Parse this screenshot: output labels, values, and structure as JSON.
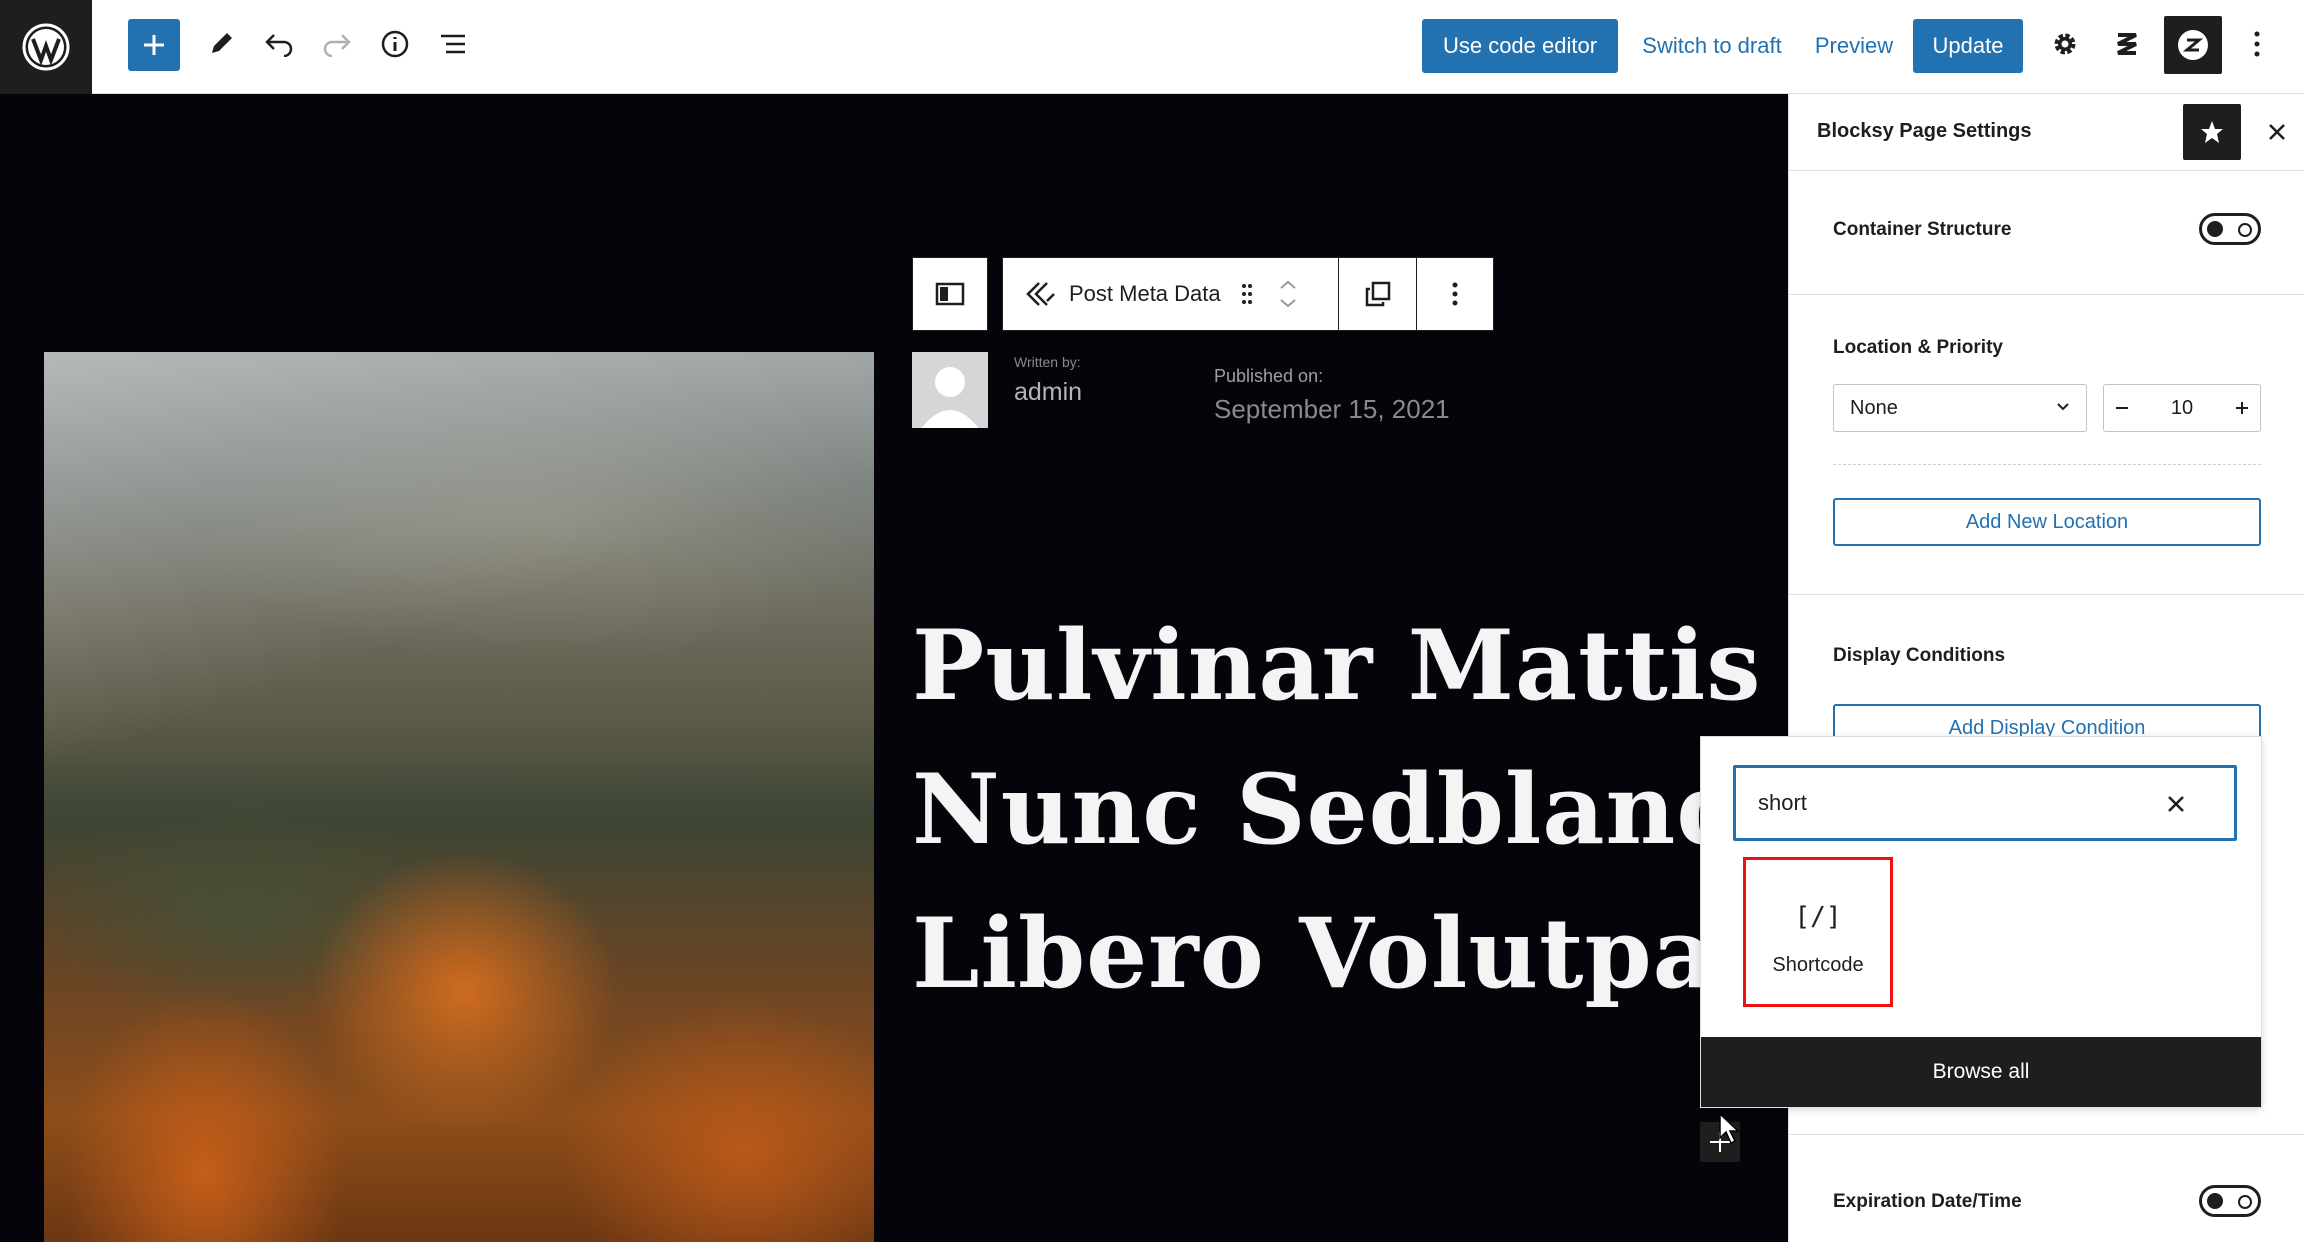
{
  "topbar": {
    "code_editor": "Use code editor",
    "switch_to_draft": "Switch to draft",
    "preview": "Preview",
    "update": "Update"
  },
  "block_toolbar": {
    "block_name": "Post Meta Data"
  },
  "post": {
    "written_by_label": "Written by:",
    "author": "admin",
    "published_label": "Published on:",
    "published_date": "September 15, 2021",
    "title_lines": [
      "Pulvinar Mattis",
      "Nunc Sedblandit",
      "Libero Volutpat"
    ]
  },
  "sidebar": {
    "title": "Blocksy Page Settings",
    "container_structure": "Container Structure",
    "container_structure_on": false,
    "location_priority": "Location & Priority",
    "location_value": "None",
    "priority_value": "10",
    "add_new_location": "Add New Location",
    "display_conditions": "Display Conditions",
    "add_display_condition": "Add Display Condition",
    "expiration": "Expiration Date/Time",
    "expiration_on": false
  },
  "inserter": {
    "search_value": "short",
    "results": [
      {
        "icon": "[/]",
        "label": "Shortcode"
      }
    ],
    "browse_all": "Browse all"
  },
  "colors": {
    "accent": "#2271b1",
    "dark": "#1e1e1e",
    "highlight": "#ee1111"
  },
  "icons": [
    "wordpress-logo-icon",
    "plus-icon",
    "pencil-icon",
    "undo-icon",
    "redo-icon",
    "info-icon",
    "list-view-icon",
    "gear-icon",
    "blocksy-icon",
    "stackable-icon",
    "more-vertical-icon",
    "star-icon",
    "close-icon",
    "chevron-down-icon",
    "minus-icon",
    "drag-handle-icon",
    "move-up-icon",
    "move-down-icon",
    "copy-icon",
    "post-meta-icon",
    "sidebar-layout-icon",
    "shortcode-icon",
    "cursor-icon"
  ]
}
